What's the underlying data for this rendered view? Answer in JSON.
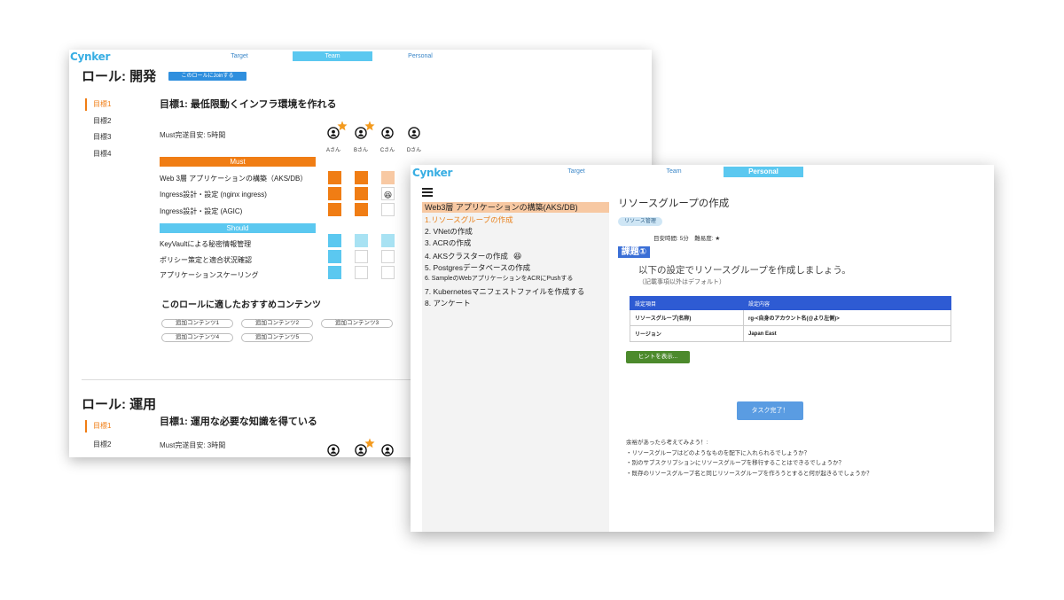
{
  "team_window": {
    "logo": "Cynker",
    "tabs": [
      {
        "label": "Target",
        "active": false
      },
      {
        "label": "Team",
        "active": true
      },
      {
        "label": "Personal",
        "active": false
      }
    ],
    "roles": [
      {
        "title": "ロール: 開発",
        "join_button": "このロールにJoinする",
        "goals_nav": [
          {
            "label": "目標1",
            "active": true
          },
          {
            "label": "目標2",
            "active": false
          },
          {
            "label": "目標3",
            "active": false
          },
          {
            "label": "目標4",
            "active": false
          }
        ],
        "goal_title": "目標1: 最低限動くインフラ環境を作れる",
        "must_estimate": "Must完遂目安: 5時間",
        "members": [
          {
            "name": "Aさん",
            "star": true
          },
          {
            "name": "Bさん",
            "star": true
          },
          {
            "name": "Cさん",
            "star": false
          },
          {
            "name": "Dさん",
            "star": false
          }
        ],
        "must_label": "Must",
        "must_tasks": [
          {
            "label": "Web 3層 アプリケーションの構築（AKS/DB）",
            "cells": [
              {
                "state": "done"
              },
              {
                "state": "done"
              },
              {
                "state": "in-progress"
              }
            ]
          },
          {
            "label": "Ingress設計・設定 (nginx ingress)",
            "cells": [
              {
                "state": "done"
              },
              {
                "state": "done"
              },
              {
                "state": "empty",
                "emoji": "😆"
              }
            ]
          },
          {
            "label": "Ingress設計・設定 (AGIC)",
            "cells": [
              {
                "state": "done"
              },
              {
                "state": "done"
              },
              {
                "state": "empty"
              }
            ]
          }
        ],
        "should_label": "Should",
        "should_tasks": [
          {
            "label": "KeyVaultによる秘密情報管理",
            "cells": [
              {
                "state": "done"
              },
              {
                "state": "in-progress"
              },
              {
                "state": "in-progress"
              }
            ]
          },
          {
            "label": "ポリシー策定と適合状況確認",
            "cells": [
              {
                "state": "done"
              },
              {
                "state": "empty"
              },
              {
                "state": "empty"
              }
            ]
          },
          {
            "label": "アプリケーションスケーリング",
            "cells": [
              {
                "state": "done"
              },
              {
                "state": "empty"
              },
              {
                "state": "empty"
              }
            ]
          }
        ],
        "recommend_title": "このロールに適したおすすめコンテンツ",
        "contents": [
          "追加コンテンツ1",
          "追加コンテンツ2",
          "追加コンテンツ3",
          "追加コンテンツ4",
          "追加コンテンツ5"
        ]
      },
      {
        "title": "ロール: 運用",
        "goals_nav": [
          {
            "label": "目標1",
            "active": true
          },
          {
            "label": "目標2",
            "active": false
          }
        ],
        "goal_title": "目標1: 運用な必要な知識を得ている",
        "must_estimate": "Must完遂目安: 3時間",
        "members": [
          {
            "star": false
          },
          {
            "star": true
          },
          {
            "star": false
          }
        ]
      }
    ]
  },
  "personal_window": {
    "logo": "Cynker",
    "tabs": [
      {
        "label": "Target",
        "active": false
      },
      {
        "label": "Team",
        "active": false
      },
      {
        "label": "Personal",
        "active": true
      }
    ],
    "menu_icon": "hamburger-icon",
    "course_title": "Web3層 アプリケーションの構築(AKS/DB)",
    "steps": [
      {
        "label": "1.リソースグループの作成",
        "active": true
      },
      {
        "label": "2. VNetの作成"
      },
      {
        "label": "3. ACRの作成"
      },
      {
        "label": "4. AKSクラスターの作成",
        "emoji": "😆"
      },
      {
        "label": "5. Postgresデータベースの作成"
      },
      {
        "label": "6. SampleのWebアプリケーションをACRにPushする"
      },
      {
        "label": "7. Kubernetesマニフェストファイルを作成する"
      },
      {
        "label": "8. アンケート"
      }
    ],
    "task": {
      "title": "リソースグループの作成",
      "tag": "リソース管理",
      "meta": "目安時間: 5分　難易度: ★",
      "assignment_label": "課題①",
      "instruction": "以下の設定でリソースグループを作成しましょう。",
      "note": "（記載事項以外はデフォルト）",
      "table": {
        "headers": [
          "設定項目",
          "設定内容"
        ],
        "rows": [
          [
            "リソースグループ(名称)",
            "rg-<自身のアカウント名(@より左側)>"
          ],
          [
            "リージョン",
            "Japan East"
          ]
        ]
      },
      "hint_button": "ヒントを表示...",
      "complete_button": "タスク完了！",
      "extra_title": "余裕があったら考えてみよう！:",
      "extra_questions": [
        "・リソースグループはどのようなものを配下に入れられるでしょうか？",
        "・別のサブスクリプションにリソースグループを移行することはできるでしょうか？",
        "・既存のリソースグループ名と同じリソースグループを作ろうとすると何が起きるでしょうか？"
      ]
    }
  },
  "colors": {
    "must": "#f07d14",
    "must_light": "#f8c9a3",
    "should": "#5bc8f0",
    "should_light": "#a8e2f3",
    "star": "#f39a1e"
  }
}
